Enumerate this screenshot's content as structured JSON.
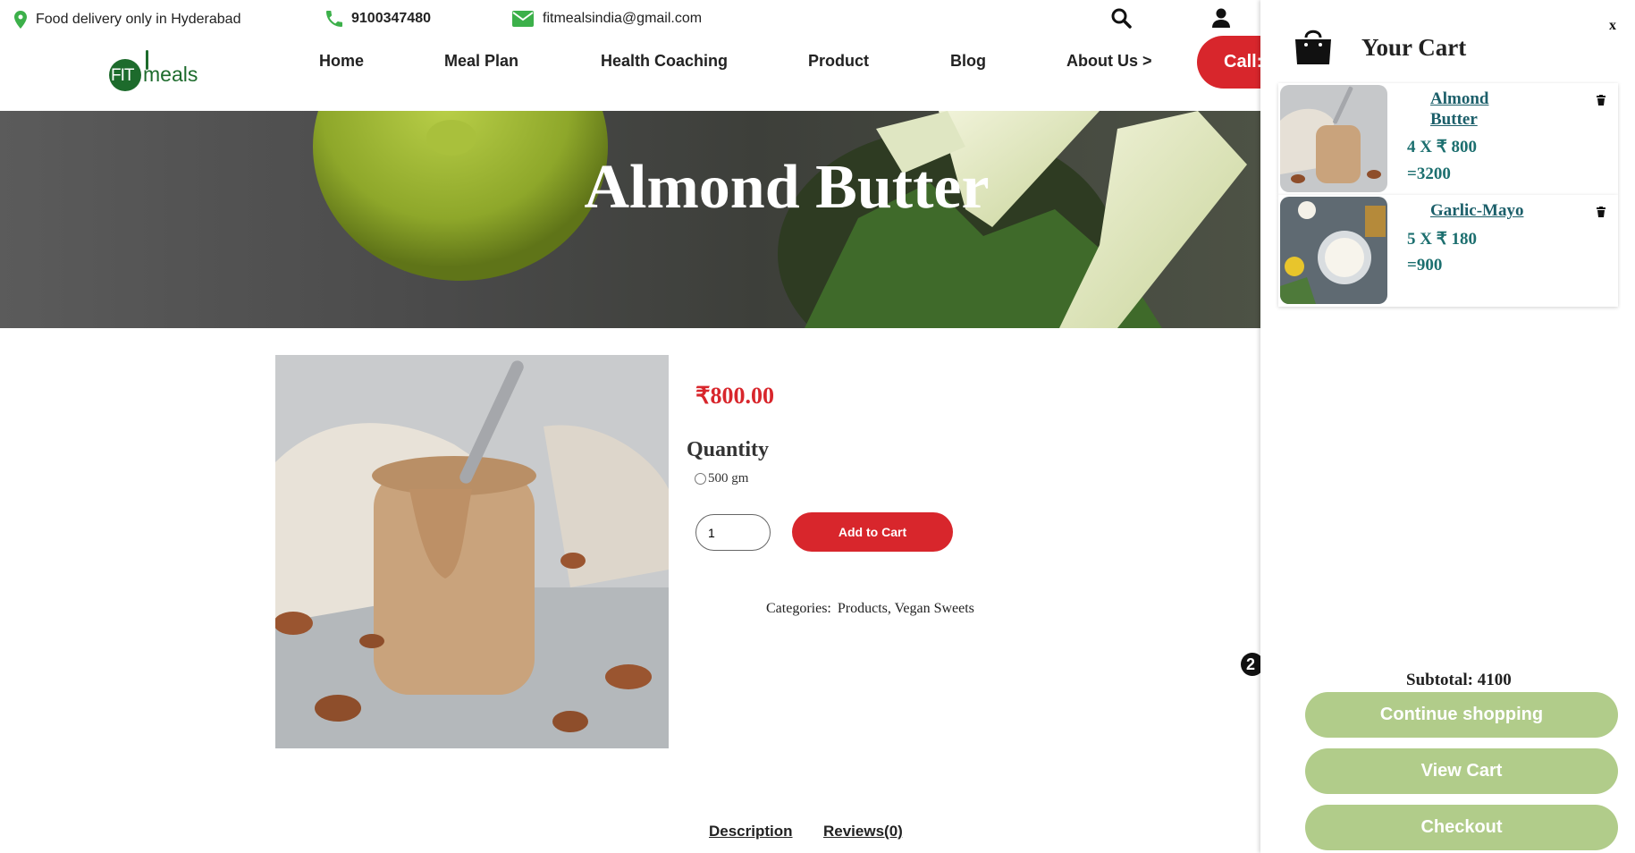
{
  "topbar": {
    "location_text": "Food delivery only in Hyderabad",
    "phone": "9100347480",
    "email": "fitmealsindia@gmail.com"
  },
  "logo": {
    "fit": "FIT",
    "meals": "meals"
  },
  "nav": {
    "items": [
      "Home",
      "Meal Plan",
      "Health Coaching",
      "Product",
      "Blog",
      "About Us >"
    ],
    "call_label": "Call:"
  },
  "hero": {
    "title": "Almond Butter"
  },
  "product": {
    "price": "₹800.00",
    "quantity_label": "Quantity",
    "option": "500 gm",
    "quantity_value": "1",
    "add_to_cart": "Add to Cart",
    "categories_label": "Categories:",
    "categories": "Products, Vegan Sweets"
  },
  "tabs": {
    "description": "Description",
    "reviews": "Reviews(0)"
  },
  "floating_badge": "2",
  "cart": {
    "close": "x",
    "title": "Your Cart",
    "items": [
      {
        "name": "Almond Butter",
        "qty_line": "4 X ₹ 800",
        "total": "=3200"
      },
      {
        "name": "Garlic-Mayo",
        "qty_line": "5 X ₹ 180",
        "total": "=900"
      }
    ],
    "subtotal": "Subtotal: 4100",
    "continue_label": "Continue shopping",
    "view_cart_label": "View Cart",
    "checkout_label": "Checkout"
  },
  "colors": {
    "accent_red": "#d8262c",
    "brand_green": "#1d6b2c",
    "drawer_button": "#b1cc8a",
    "cart_teal": "#1c6f6f"
  }
}
